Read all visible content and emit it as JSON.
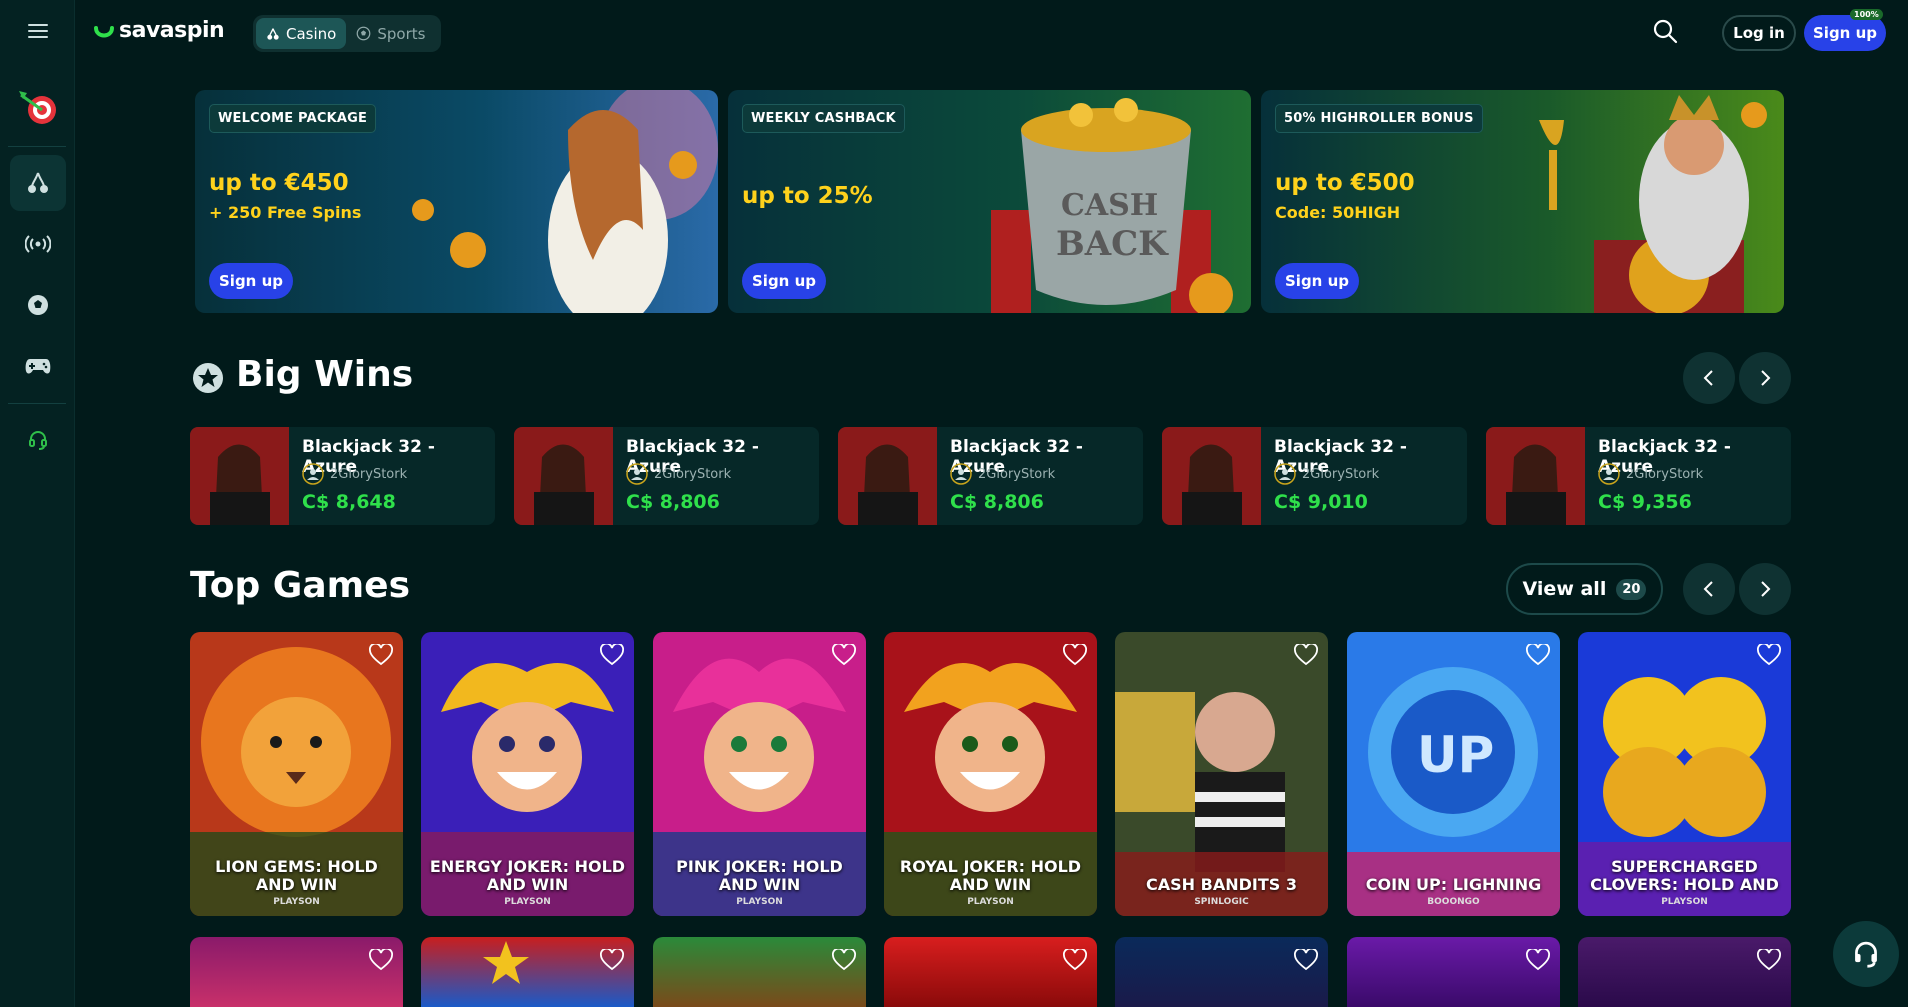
{
  "header": {
    "brand": "savaspin",
    "tabs": [
      {
        "label": "Casino",
        "active": true
      },
      {
        "label": "Sports",
        "active": false
      }
    ],
    "login_label": "Log in",
    "signup_label": "Sign up",
    "signup_badge": "100%"
  },
  "sidebar": {
    "items": [
      {
        "icon": "menu-icon"
      },
      {
        "icon": "dart-target-icon"
      },
      {
        "icon": "cherries-icon",
        "active": true
      },
      {
        "icon": "live-broadcast-icon"
      },
      {
        "icon": "football-icon"
      },
      {
        "icon": "gamepad-icon"
      },
      {
        "icon": "headset-icon"
      }
    ]
  },
  "promos": [
    {
      "tag": "WELCOME PACKAGE",
      "main": "up to €450",
      "sub": "+ 250 Free Spins",
      "button": "Sign up"
    },
    {
      "tag": "WEEKLY CASHBACK",
      "main": "up to 25%",
      "sub": "",
      "button": "Sign up"
    },
    {
      "tag": "50% HIGHROLLER BONUS",
      "main": "up to €500",
      "sub": "Code: 50HIGH",
      "button": "Sign up"
    }
  ],
  "big_wins": {
    "title": "Big Wins",
    "items": [
      {
        "game": "Blackjack 32 - Azure",
        "user": "2GloryStork",
        "amount": "C$ 8,648"
      },
      {
        "game": "Blackjack 32 - Azure",
        "user": "2GloryStork",
        "amount": "C$ 8,806"
      },
      {
        "game": "Blackjack 32 - Azure",
        "user": "2GloryStork",
        "amount": "C$ 8,806"
      },
      {
        "game": "Blackjack 32 - Azure",
        "user": "2GloryStork",
        "amount": "C$ 9,010"
      },
      {
        "game": "Blackjack 32 - Azure",
        "user": "2GloryStork",
        "amount": "C$ 9,356"
      }
    ]
  },
  "top_games": {
    "title": "Top Games",
    "view_all_label": "View all",
    "view_all_count": "20",
    "items": [
      {
        "name": "LION GEMS: HOLD AND WIN",
        "provider": "PLAYSON"
      },
      {
        "name": "ENERGY JOKER: HOLD AND WIN",
        "provider": "PLAYSON"
      },
      {
        "name": "PINK JOKER: HOLD AND WIN",
        "provider": "PLAYSON"
      },
      {
        "name": "ROYAL JOKER: HOLD AND WIN",
        "provider": "PLAYSON"
      },
      {
        "name": "CASH BANDITS 3",
        "provider": "SPINLOGIC"
      },
      {
        "name": "COIN UP: LIGHNING",
        "provider": "BOOONGO"
      },
      {
        "name": "SUPERCHARGED CLOVERS: HOLD AND",
        "provider": "PLAYSON"
      }
    ]
  },
  "colors": {
    "accent": "#2842e8",
    "win_green": "#2fe04b",
    "promo_yellow": "#ffd21c",
    "background": "#011a1a"
  }
}
